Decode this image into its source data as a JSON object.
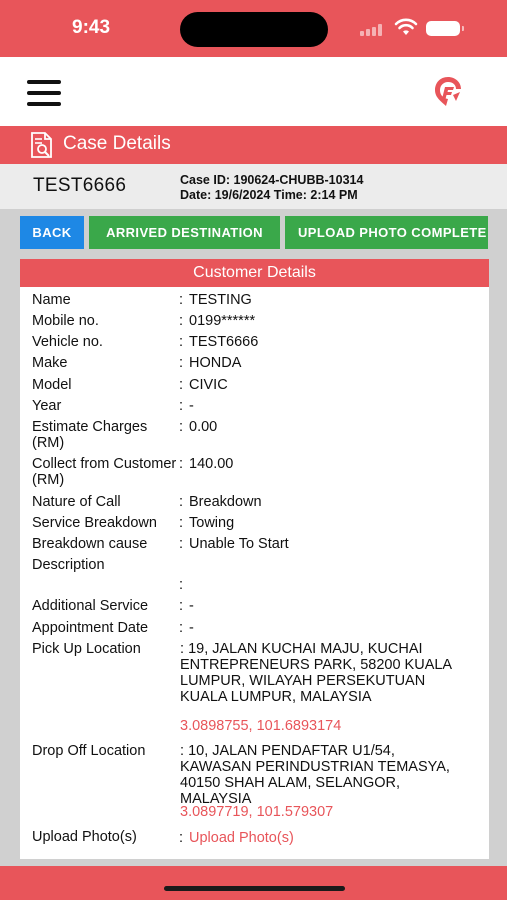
{
  "status_bar": {
    "time": "9:43"
  },
  "header": {
    "menu_icon": "hamburger-menu-icon",
    "logo_icon": "app-logo-icon"
  },
  "section": {
    "title": "Case Details",
    "icon": "document-search-icon"
  },
  "case": {
    "vehicle_no": "TEST6666",
    "case_id_line": "Case ID: 190624-CHUBB-10314",
    "date_line": "Date: 19/6/2024 Time: 2:14 PM"
  },
  "actions": {
    "back": "BACK",
    "arrived": "ARRIVED DESTINATION",
    "upload": "UPLOAD PHOTO COMPLETE"
  },
  "customer": {
    "title": "Customer Details",
    "rows": [
      {
        "label": "Name",
        "value": "TESTING"
      },
      {
        "label": "Mobile no.",
        "value": "0199******"
      },
      {
        "label": "Vehicle no.",
        "value": "TEST6666"
      },
      {
        "label": "Make",
        "value": "HONDA"
      },
      {
        "label": "Model",
        "value": "CIVIC"
      },
      {
        "label": "Year",
        "value": "-"
      },
      {
        "label": "Estimate Charges (RM)",
        "value": "0.00"
      },
      {
        "label": "Collect from Customer (RM)",
        "value": "140.00"
      },
      {
        "label": "Nature of Call",
        "value": "Breakdown"
      },
      {
        "label": "Service Breakdown",
        "value": "Towing"
      },
      {
        "label": "Breakdown cause",
        "value": "Unable To Start"
      },
      {
        "label": "Description",
        "value": ""
      },
      {
        "label": "Additional Service",
        "value": "-"
      },
      {
        "label": "Appointment Date",
        "value": "-"
      }
    ],
    "pickup": {
      "label": "Pick Up Location",
      "address": "19, JALAN KUCHAI MAJU, KUCHAI ENTREPRENEURS PARK, 58200 KUALA LUMPUR, WILAYAH PERSEKUTUAN KUALA LUMPUR, MALAYSIA",
      "coords": "3.0898755, 101.6893174"
    },
    "dropoff": {
      "label": "Drop Off Location",
      "address": "10, JALAN PENDAFTAR U1/54, KAWASAN PERINDUSTRIAN TEMASYA, 40150 SHAH ALAM, SELANGOR, MALAYSIA",
      "coords": "3.0897719, 101.579307"
    },
    "upload": {
      "label": "Upload Photo(s)",
      "link": "Upload Photo(s)"
    }
  },
  "colors": {
    "brand_red": "#e8555a",
    "back_blue": "#1e88e5",
    "action_green": "#3aa84a"
  }
}
